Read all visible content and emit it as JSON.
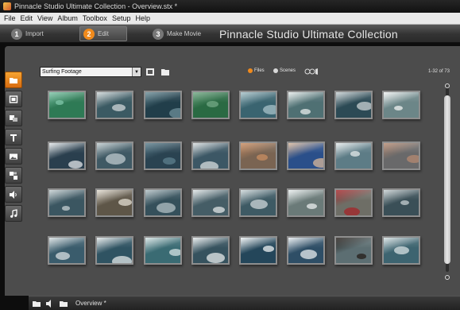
{
  "window": {
    "title": "Pinnacle Studio Ultimate Collection - Overview.stx *"
  },
  "menu": {
    "items": [
      "File",
      "Edit",
      "View",
      "Album",
      "Toolbox",
      "Setup",
      "Help"
    ]
  },
  "modes": [
    {
      "number": "1",
      "label": "Import"
    },
    {
      "number": "2",
      "label": "Edit"
    },
    {
      "number": "3",
      "label": "Make Movie"
    }
  ],
  "app_name": "Pinnacle Studio Ultimate Collection",
  "album": {
    "selected": "Surfing Footage",
    "view_options": [
      "Files",
      "Scenes"
    ],
    "active_view": "Files",
    "count": "1-32 of 73"
  },
  "tools": [
    "folder-icon",
    "video-icon",
    "transition-icon",
    "title-icon",
    "photo-icon",
    "menu-icon",
    "sound-icon",
    "music-icon"
  ],
  "thumbnails": [
    {
      "bg": "#2e7a55",
      "fg": "#7fc5a8"
    },
    {
      "bg": "#3b5a63",
      "fg": "#cfd6d7"
    },
    {
      "bg": "#213e4a",
      "fg": "#6e8f99"
    },
    {
      "bg": "#2a6a43",
      "fg": "#74a986"
    },
    {
      "bg": "#3a6470",
      "fg": "#a8c2c8"
    },
    {
      "bg": "#4f7073",
      "fg": "#e6ebea"
    },
    {
      "bg": "#2c4a55",
      "fg": "#c9d1d3"
    },
    {
      "bg": "#6c8688",
      "fg": "#f0f2f2"
    },
    {
      "bg": "#2a3f4e",
      "fg": "#e2e6e8"
    },
    {
      "bg": "#3f5964",
      "fg": "#bfcacd"
    },
    {
      "bg": "#2a4351",
      "fg": "#5d7f8d"
    },
    {
      "bg": "#3c5765",
      "fg": "#d7dcdd"
    },
    {
      "bg": "#7a6452",
      "fg": "#c98d62"
    },
    {
      "bg": "#2a4f8a",
      "fg": "#d8b79a"
    },
    {
      "bg": "#5d7c86",
      "fg": "#e4e9ea"
    },
    {
      "bg": "#69696a",
      "fg": "#b58a72"
    },
    {
      "bg": "#3b5661",
      "fg": "#c5cfd1"
    },
    {
      "bg": "#5e5648",
      "fg": "#e3ddd2"
    },
    {
      "bg": "#35505b",
      "fg": "#b1bfc3"
    },
    {
      "bg": "#455d66",
      "fg": "#dfe4e5"
    },
    {
      "bg": "#3e5a64",
      "fg": "#cdd6d8"
    },
    {
      "bg": "#6a7a78",
      "fg": "#e9eeee"
    },
    {
      "bg": "#6e6e66",
      "fg": "#a5262a"
    },
    {
      "bg": "#3a4f57",
      "fg": "#c6ced0"
    },
    {
      "bg": "#3a5c6c",
      "fg": "#d7dee0"
    },
    {
      "bg": "#2f5362",
      "fg": "#e1e6e7"
    },
    {
      "bg": "#3a6b73",
      "fg": "#d6e3e3"
    },
    {
      "bg": "#36525e",
      "fg": "#e5e9ea"
    },
    {
      "bg": "#24465a",
      "fg": "#eef2f3"
    },
    {
      "bg": "#2e4e66",
      "fg": "#e6ebee"
    },
    {
      "bg": "#5c6e72",
      "fg": "#241d19"
    },
    {
      "bg": "#3d6470",
      "fg": "#d7e0e1"
    }
  ],
  "bottom": {
    "project_name": "Overview *"
  },
  "colors": {
    "accent": "#f08a1c",
    "panel": "#4c4c4c"
  }
}
